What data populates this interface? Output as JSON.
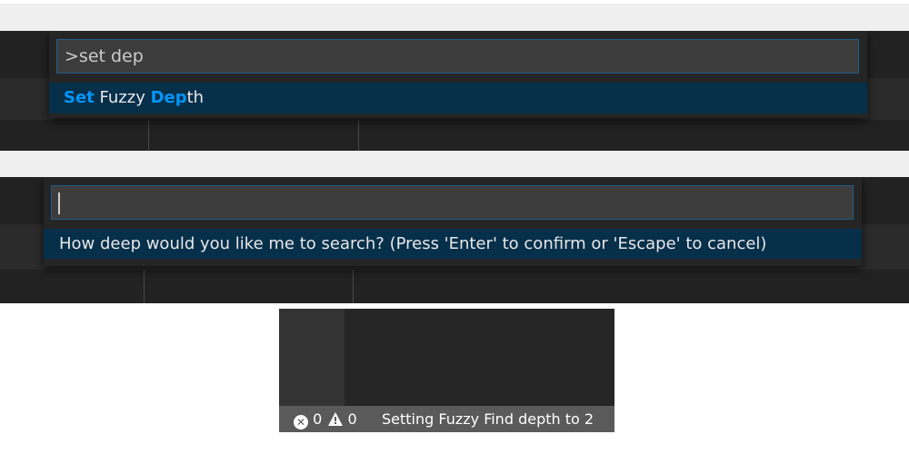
{
  "palette1": {
    "input_value": ">set dep",
    "result": {
      "match1": "Set",
      "space1": " ",
      "plain1": "Fuzzy",
      "space2": " ",
      "match2": "Dep",
      "plain2": "th"
    }
  },
  "palette2": {
    "input_value": "",
    "prompt_message": "How deep would you like me to search? (Press 'Enter' to confirm or 'Escape' to cancel)"
  },
  "statusbar": {
    "errors_count": "0",
    "warnings_count": "0",
    "message": "Setting Fuzzy Find depth to 2"
  },
  "icons": {
    "error": "error-icon",
    "warning": "warning-icon"
  },
  "colors": {
    "match_highlight": "#0097fb",
    "selected_row": "#062f4a",
    "input_border": "#1f5d8a",
    "statusbar_bg": "#5a5a5a"
  }
}
